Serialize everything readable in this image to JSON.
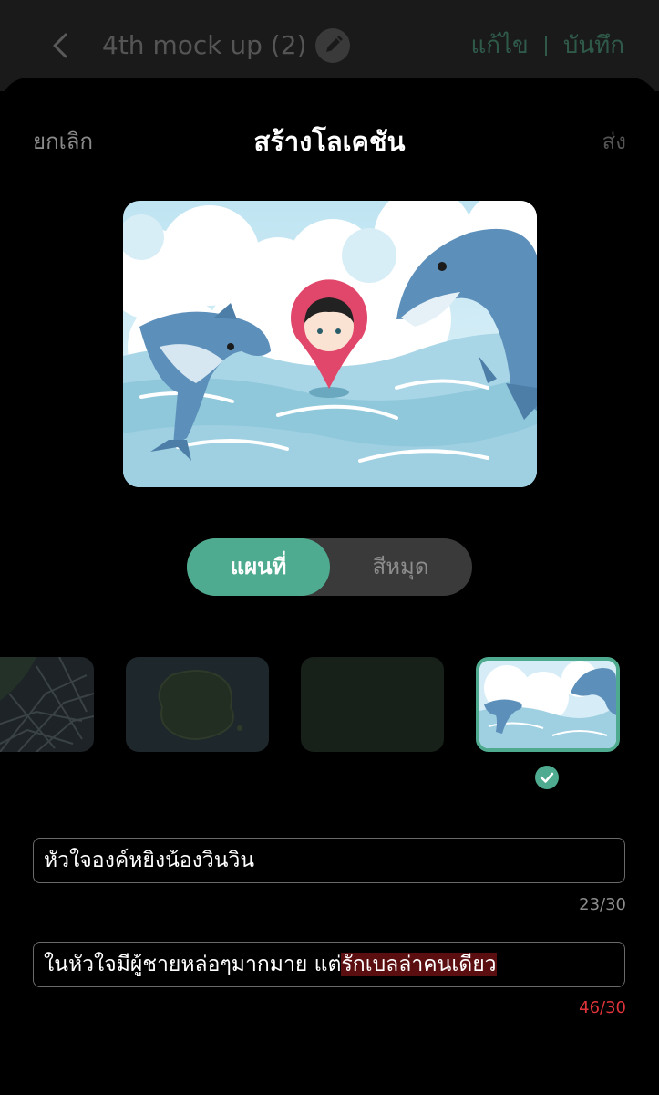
{
  "header": {
    "document_title": "4th mock up (2)",
    "edit_label": "แก้ไข",
    "save_label": "บันทึก"
  },
  "sheet": {
    "cancel_label": "ยกเลิก",
    "title": "สร้างโลเคชัน",
    "send_label": "ส่ง"
  },
  "view_toggle": {
    "options": [
      "แผนที่",
      "สีหมุด"
    ],
    "selected": "แผนที่"
  },
  "map_styles": {
    "items": [
      {
        "name": "street-map-thumbnail"
      },
      {
        "name": "island-map-thumbnail"
      },
      {
        "name": "dark-terrain-thumbnail"
      },
      {
        "name": "dolphin-theme-thumbnail"
      }
    ],
    "selected_index": 3
  },
  "name_field": {
    "value": "หัวใจองค์หยิงน้องวินวิน",
    "counter": "23/30"
  },
  "description_field": {
    "value_within_limit": "ในหัวใจมีผู้ชายหล่อๆมากมาย แต่",
    "value_over_limit": "รักเบลล่าคนเดียว",
    "counter": "46/30"
  },
  "colors": {
    "accent": "#4fab8f",
    "error": "#e0343a",
    "background": "#000000"
  }
}
